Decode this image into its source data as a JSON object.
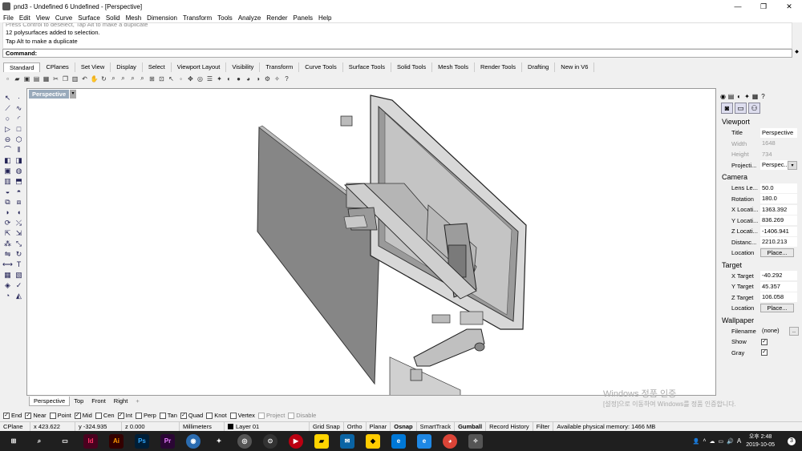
{
  "window": {
    "title": "pnd3 - Undefined 6 Undefined - [Perspective]",
    "controls": {
      "minimize": "—",
      "maximize": "❐",
      "close": "✕"
    }
  },
  "menu": [
    "File",
    "Edit",
    "View",
    "Curve",
    "Surface",
    "Solid",
    "Mesh",
    "Dimension",
    "Transform",
    "Tools",
    "Analyze",
    "Render",
    "Panels",
    "Help"
  ],
  "command_history": {
    "faded_line": "Press Control to deselect, Tap Alt to make a duplicate",
    "lines": [
      "12 polysurfaces added to selection.",
      "Tap Alt to make a duplicate"
    ],
    "prompt_label": "Command:",
    "prompt_value": ""
  },
  "toolbar_tabs": [
    "Standard",
    "CPlanes",
    "Set View",
    "Display",
    "Select",
    "Viewport Layout",
    "Visibility",
    "Transform",
    "Curve Tools",
    "Surface Tools",
    "Solid Tools",
    "Mesh Tools",
    "Render Tools",
    "Drafting",
    "New in V6"
  ],
  "active_tab": "Standard",
  "viewport": {
    "label": "Perspective",
    "dropdown": "▾",
    "tabs": [
      "Perspective",
      "Top",
      "Front",
      "Right"
    ],
    "add_tab": "+"
  },
  "osnaps": [
    {
      "label": "End",
      "checked": true
    },
    {
      "label": "Near",
      "checked": true
    },
    {
      "label": "Point",
      "checked": false
    },
    {
      "label": "Mid",
      "checked": true
    },
    {
      "label": "Cen",
      "checked": false
    },
    {
      "label": "Int",
      "checked": true
    },
    {
      "label": "Perp",
      "checked": false
    },
    {
      "label": "Tan",
      "checked": false
    },
    {
      "label": "Quad",
      "checked": true
    },
    {
      "label": "Knot",
      "checked": false
    },
    {
      "label": "Vertex",
      "checked": false
    },
    {
      "label": "Project",
      "checked": false,
      "dim": true
    },
    {
      "label": "Disable",
      "checked": false,
      "dim": true
    }
  ],
  "status_bar": {
    "cplane": "CPlane",
    "x": "x 423.622",
    "y": "y -324.935",
    "z": "z 0.000",
    "units": "Millimeters",
    "layer": "Layer 01",
    "grid_snap": "Grid Snap",
    "ortho": "Ortho",
    "planar": "Planar",
    "osnap": "Osnap",
    "smarttrack": "SmartTrack",
    "gumball": "Gumball",
    "record_history": "Record History",
    "filter": "Filter",
    "memory": "Available physical memory: 1466 MB"
  },
  "watermark": {
    "title": "Windows 정품 인증",
    "subtitle": "[설정]으로 이동하여 Windows를 정품 인증합니다."
  },
  "properties": {
    "viewport_section": "Viewport",
    "title_label": "Title",
    "title_value": "Perspective",
    "width_label": "Width",
    "width_value": "1648",
    "height_label": "Height",
    "height_value": "734",
    "projection_label": "Projecti...",
    "projection_value": "Perspec...",
    "camera_section": "Camera",
    "lens_label": "Lens Le...",
    "lens_value": "50.0",
    "rotation_label": "Rotation",
    "rotation_value": "180.0",
    "xloc_label": "X Locati...",
    "xloc_value": "1363.392",
    "yloc_label": "Y Locati...",
    "yloc_value": "836.269",
    "zloc_label": "Z Locati...",
    "zloc_value": "-1406.941",
    "distance_label": "Distanc...",
    "distance_value": "2210.213",
    "location_label": "Location",
    "place_button": "Place...",
    "target_section": "Target",
    "xt_label": "X Target",
    "xt_value": "-40.292",
    "yt_label": "Y Target",
    "yt_value": "45.357",
    "zt_label": "Z Target",
    "zt_value": "106.058",
    "tlocation_label": "Location",
    "tplace_button": "Place...",
    "wallpaper_section": "Wallpaper",
    "filename_label": "Filename",
    "filename_value": "(none)",
    "filename_button": "..",
    "show_label": "Show",
    "gray_label": "Gray",
    "check": "✓"
  },
  "taskbar": {
    "apps": [
      "Id",
      "Ai",
      "Ps",
      "Pr"
    ],
    "clock_time": "오후 2:48",
    "clock_date": "2019-10-05",
    "ime": "A",
    "notifications": "3"
  },
  "colors": {
    "viewport_bg": "#ffffff",
    "label_bg": "#99aabb",
    "taskbar": "#1f1f1f"
  }
}
